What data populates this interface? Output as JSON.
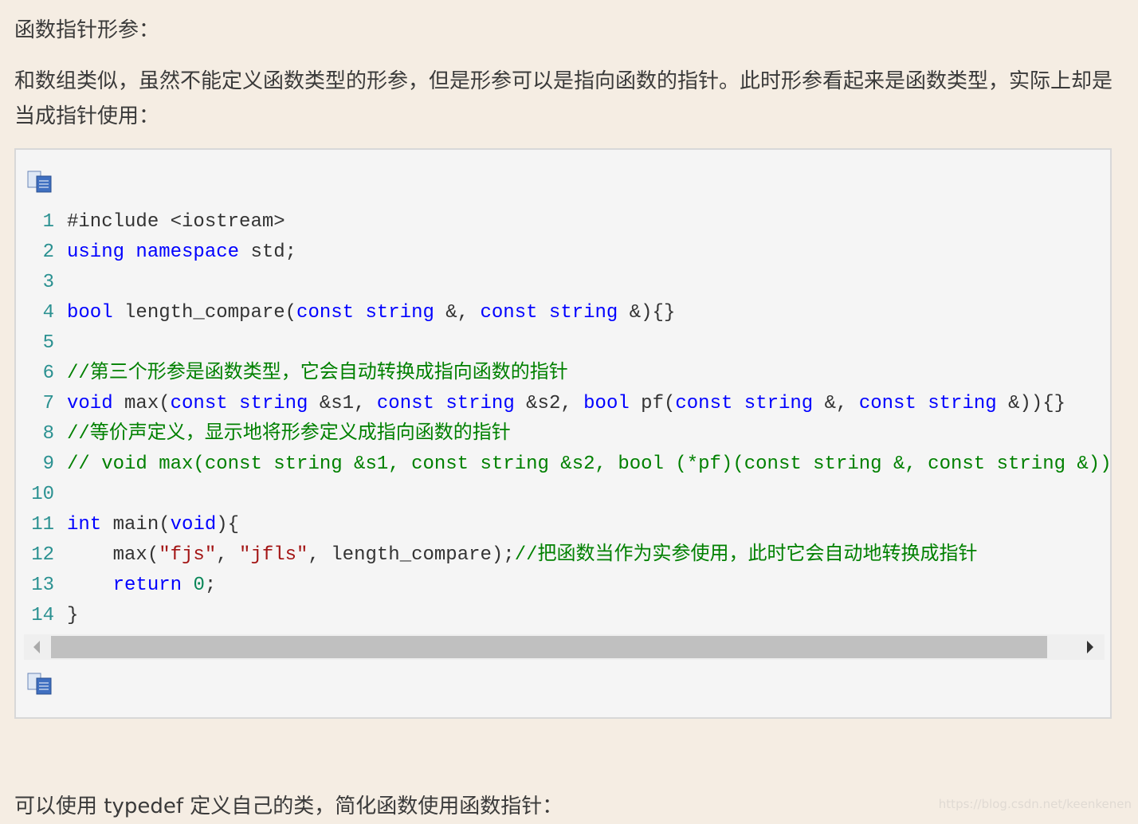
{
  "heading": "函数指针形参：",
  "intro": "和数组类似，虽然不能定义函数类型的形参，但是形参可以是指向函数的指针。此时形参看起来是函数类型，实际上却是当成指针使用：",
  "code_block": {
    "copy_icon": "copy-code-icon",
    "lines": [
      [
        [
          "t",
          "#include <iostream>"
        ]
      ],
      [
        [
          "k",
          "using"
        ],
        [
          "t",
          " "
        ],
        [
          "k",
          "namespace"
        ],
        [
          "t",
          " std;"
        ]
      ],
      [],
      [
        [
          "k",
          "bool"
        ],
        [
          "t",
          " length_compare("
        ],
        [
          "k",
          "const"
        ],
        [
          "t",
          " "
        ],
        [
          "k",
          "string"
        ],
        [
          "t",
          " &, "
        ],
        [
          "k",
          "const"
        ],
        [
          "t",
          " "
        ],
        [
          "k",
          "string"
        ],
        [
          "t",
          " &){}"
        ]
      ],
      [],
      [
        [
          "c",
          "//第三个形参是函数类型，它会自动转换成指向函数的指针"
        ]
      ],
      [
        [
          "k",
          "void"
        ],
        [
          "t",
          " max("
        ],
        [
          "k",
          "const"
        ],
        [
          "t",
          " "
        ],
        [
          "k",
          "string"
        ],
        [
          "t",
          " &s1, "
        ],
        [
          "k",
          "const"
        ],
        [
          "t",
          " "
        ],
        [
          "k",
          "string"
        ],
        [
          "t",
          " &s2, "
        ],
        [
          "k",
          "bool"
        ],
        [
          "t",
          " pf("
        ],
        [
          "k",
          "const"
        ],
        [
          "t",
          " "
        ],
        [
          "k",
          "string"
        ],
        [
          "t",
          " &, "
        ],
        [
          "k",
          "const"
        ],
        [
          "t",
          " "
        ],
        [
          "k",
          "string"
        ],
        [
          "t",
          " &)){}"
        ]
      ],
      [
        [
          "c",
          "//等价声定义，显示地将形参定义成指向函数的指针"
        ]
      ],
      [
        [
          "c",
          "// void max(const string &s1, const string &s2, bool (*pf)(const string &, const string &))"
        ]
      ],
      [],
      [
        [
          "k",
          "int"
        ],
        [
          "t",
          " main("
        ],
        [
          "k",
          "void"
        ],
        [
          "t",
          "){"
        ]
      ],
      [
        [
          "t",
          "    max("
        ],
        [
          "s",
          "\"fjs\""
        ],
        [
          "t",
          ", "
        ],
        [
          "s",
          "\"jfls\""
        ],
        [
          "t",
          ", length_compare);"
        ],
        [
          "c",
          "//把函数当作为实参使用，此时它会自动地转换成指针"
        ]
      ],
      [
        [
          "t",
          "    "
        ],
        [
          "k",
          "return"
        ],
        [
          "t",
          " "
        ],
        [
          "n",
          "0"
        ],
        [
          "t",
          ";"
        ]
      ],
      [
        [
          "t",
          "}"
        ]
      ]
    ]
  },
  "next_paragraph": "可以使用 typedef 定义自己的类，简化函数使用函数指针：",
  "watermark": "https://blog.csdn.net/keenkenen"
}
